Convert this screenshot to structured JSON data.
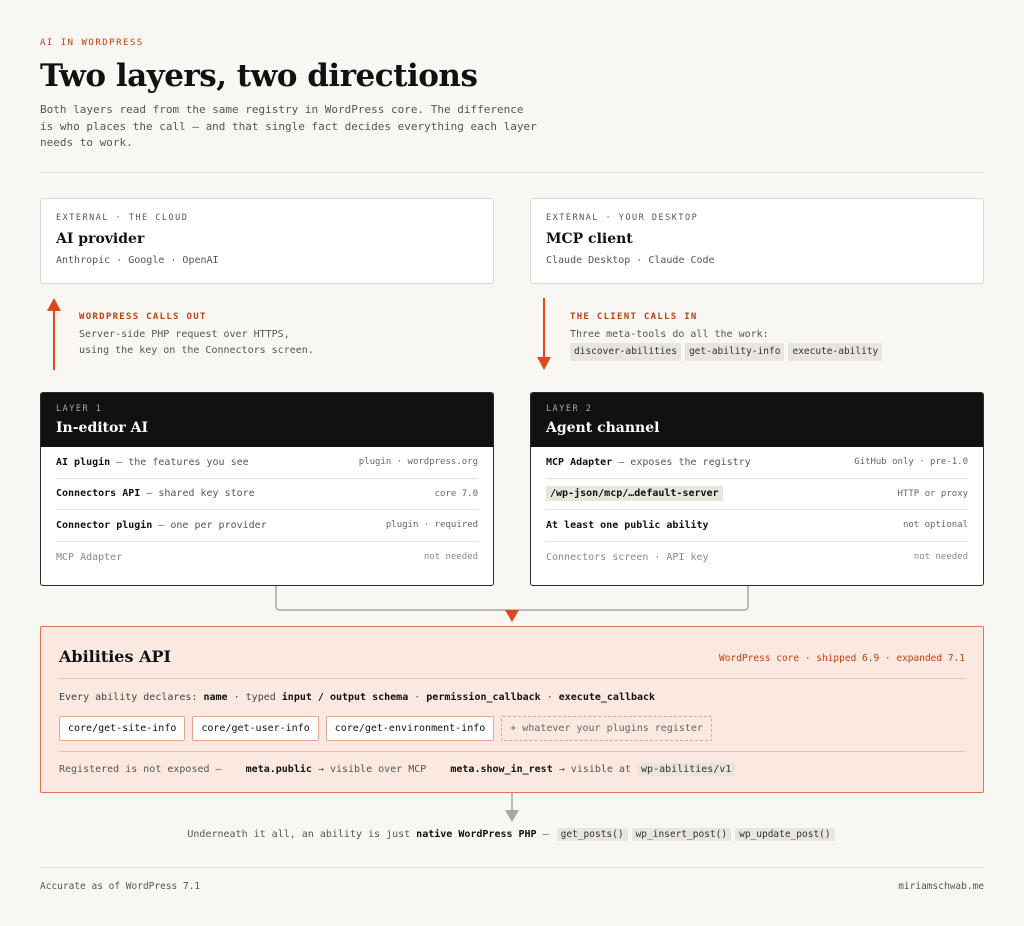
{
  "header": {
    "eyebrow": "AI IN WORDPRESS",
    "title": "Two layers, two directions",
    "intro": "Both layers read from the same registry in WordPress core. The difference is who places the call — and that single fact decides everything each layer needs to work."
  },
  "external": [
    {
      "kicker": "EXTERNAL · THE CLOUD",
      "name": "AI provider",
      "sub": "Anthropic · Google · OpenAI"
    },
    {
      "kicker": "EXTERNAL · YOUR DESKTOP",
      "name": "MCP client",
      "sub": "Claude Desktop · Claude Code"
    }
  ],
  "flows": {
    "out": {
      "label": "WORDPRESS CALLS OUT",
      "line1": "Server-side PHP request over HTTPS,",
      "line2": "using the key on the Connectors screen."
    },
    "in": {
      "label": "THE CLIENT CALLS IN",
      "line1": "Three meta-tools do all the work:",
      "tools": [
        "discover-abilities",
        "get-ability-info",
        "execute-ability"
      ]
    }
  },
  "layers": [
    {
      "kicker": "LAYER 1",
      "name": "In-editor AI",
      "rows": [
        {
          "strong": "AI plugin",
          "rest": " — the features you see",
          "right": "plugin · wordpress.org"
        },
        {
          "strong": "Connectors API",
          "rest": " — shared key store",
          "right": "core 7.0"
        },
        {
          "strong": "Connector plugin",
          "rest": " — one per provider",
          "right": "plugin · required"
        },
        {
          "strong": "",
          "rest": "MCP Adapter",
          "right": "not needed"
        }
      ]
    },
    {
      "kicker": "LAYER 2",
      "name": "Agent channel",
      "rows": [
        {
          "strong": "MCP Adapter",
          "rest": " — exposes the registry",
          "right": "GitHub only · pre-1.0"
        },
        {
          "path": "/wp-json/mcp/…default-server",
          "right": "HTTP or proxy"
        },
        {
          "strong": "At least one public ability",
          "rest": "",
          "right": "not optional"
        },
        {
          "strong": "",
          "rest": "Connectors screen · API key",
          "right": "not needed"
        }
      ]
    }
  ],
  "abilities": {
    "title": "Abilities API",
    "meta": "WordPress core · shipped 6.9 · expanded 7.1",
    "declares_prefix": "Every ability declares: ",
    "declares": {
      "name": "name",
      "typed": " · typed ",
      "schema": "input / output schema",
      "sep1": " · ",
      "perm": "permission_callback",
      "sep2": " · ",
      "exec": "execute_callback"
    },
    "chips": [
      "core/get-site-info",
      "core/get-user-info",
      "core/get-environment-info"
    ],
    "extra_chip": "+ whatever your plugins register",
    "registered": {
      "prefix": "Registered is not exposed —",
      "public": "meta.public",
      "public_desc": " → visible over MCP",
      "rest": "meta.show_in_rest",
      "rest_desc": " → visible at ",
      "rest_chip": "wp-abilities/v1"
    }
  },
  "native": {
    "prefix": "Underneath it all, an ability is just ",
    "strong": "native WordPress PHP",
    "dash": " — ",
    "funcs": [
      "get_posts()",
      "wp_insert_post()",
      "wp_update_post()"
    ]
  },
  "footer": {
    "left": "Accurate as of WordPress 7.1",
    "right": "miriamschwab.me"
  },
  "colors": {
    "accent": "#c2410c",
    "arrow": "#e0491b",
    "abilities_bg": "#fbe9e1",
    "abilities_border": "#e3734a",
    "dark": "#111111"
  }
}
